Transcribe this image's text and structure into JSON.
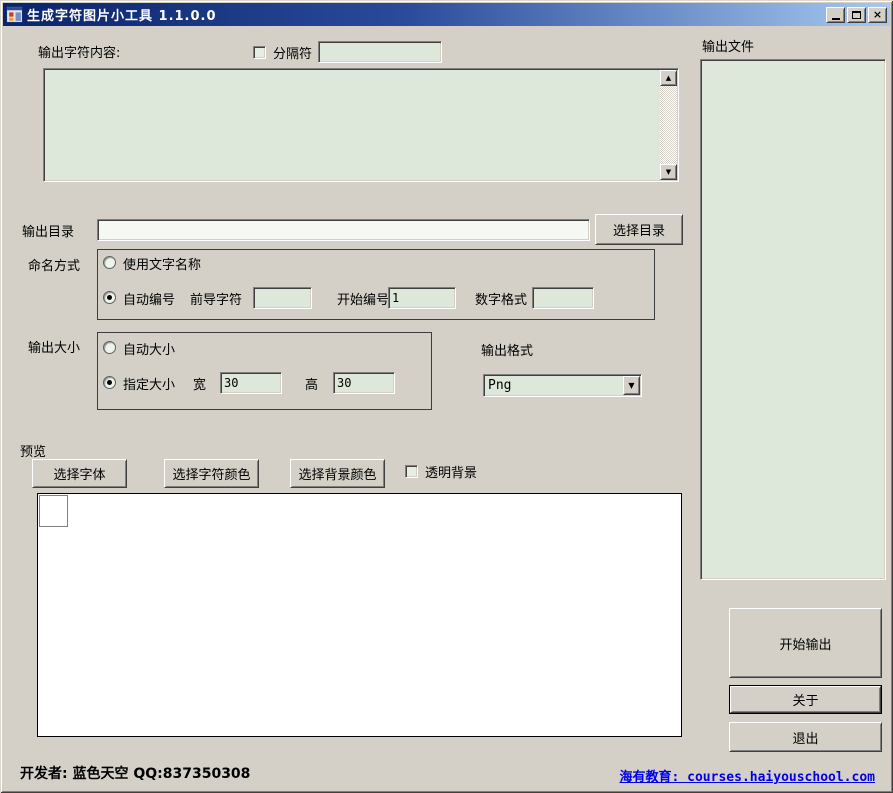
{
  "window": {
    "title": "生成字符图片小工具 1.1.0.0",
    "controls": {
      "minimize": "minimize",
      "maximize": "maximize",
      "close": "×"
    }
  },
  "content": {
    "char_content_label": "输出字符内容:",
    "separator": {
      "checkbox_label": "分隔符",
      "value": ""
    },
    "char_textarea_value": "",
    "output_dir": {
      "label": "输出目录",
      "value": "",
      "choose_button": "选择目录"
    },
    "naming": {
      "label": "命名方式",
      "radio_text_name": "使用文字名称",
      "radio_auto_number": "自动编号",
      "leading_char_label": "前导字符",
      "leading_char_value": "",
      "start_number_label": "开始编号",
      "start_number_value": "1",
      "number_format_label": "数字格式",
      "number_format_value": ""
    },
    "size": {
      "label": "输出大小",
      "radio_auto": "自动大小",
      "radio_fixed": "指定大小",
      "width_label": "宽",
      "width_value": "30",
      "height_label": "高",
      "height_value": "30"
    },
    "format": {
      "label": "输出格式",
      "value": "Png"
    },
    "preview": {
      "label": "预览",
      "font_button": "选择字体",
      "char_color_button": "选择字符颜色",
      "bg_color_button": "选择背景颜色",
      "transparent_checkbox_label": "透明背景"
    },
    "output_files_label": "输出文件",
    "actions": {
      "start": "开始输出",
      "about": "关于",
      "exit": "退出"
    },
    "footer": {
      "developer": "开发者: 蓝色天空 QQ:837350308",
      "link": "海有教育: courses.haiyouschool.com"
    }
  },
  "colors": {
    "window_face": "#d4d0c8",
    "titlebar_gradient_start": "#0a246a",
    "titlebar_gradient_end": "#a6caf0",
    "field_green": "#dde8da",
    "preview_bg": "#ffffff",
    "link_blue": "#0000ee"
  }
}
